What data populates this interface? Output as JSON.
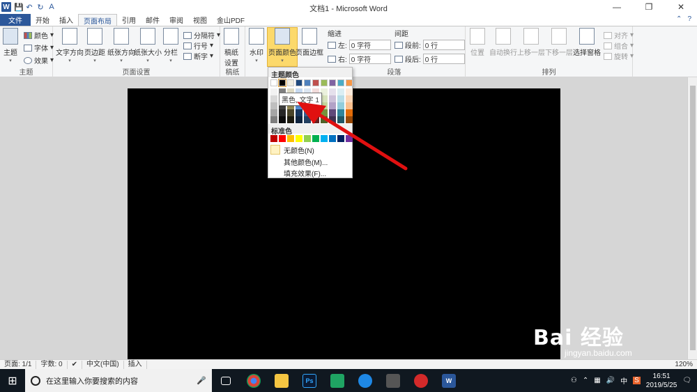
{
  "window": {
    "title": "文档1 - Microsoft Word",
    "minimize": "—",
    "restore": "❐",
    "close": "✕"
  },
  "qat": {
    "logo": "W",
    "save": "💾",
    "undo": "↶",
    "redo": "↻",
    "format": "A"
  },
  "tabs": [
    "文件",
    "开始",
    "插入",
    "页面布局",
    "引用",
    "邮件",
    "审阅",
    "视图",
    "金山PDF"
  ],
  "active_tab": "页面布局",
  "ribbon": {
    "theme_group": {
      "label": "主题",
      "theme_btn": "主题",
      "colors": "颜色",
      "fonts": "字体",
      "effects": "效果"
    },
    "page_setup": {
      "label": "页面设置",
      "text_dir": "文字方向",
      "margins": "页边距",
      "orientation": "纸张方向",
      "size": "纸张大小",
      "columns": "分栏",
      "breaks": "分隔符",
      "line_numbers": "行号",
      "hyphenation": "断字"
    },
    "draft": {
      "label": "稿纸",
      "btn_line1": "稿纸",
      "btn_line2": "设置"
    },
    "background": {
      "watermark": "水印",
      "page_color": "页面颜色",
      "page_border": "页面边框"
    },
    "paragraph": {
      "label": "段落",
      "indent": "缩进",
      "spacing": "间距",
      "left_label": "左:",
      "left_val": "0 字符",
      "right_label": "右:",
      "right_val": "0 字符",
      "before_label": "段前:",
      "before_val": "0 行",
      "after_label": "段后:",
      "after_val": "0 行"
    },
    "arrange": {
      "label": "排列",
      "position": "位置",
      "wrap": "自动换行",
      "forward": "上移一层",
      "backward": "下移一层",
      "selection": "选择窗格",
      "align": "对齐",
      "group": "组合",
      "rotate": "旋转"
    }
  },
  "page_color_menu": {
    "theme_colors_header": "主题颜色",
    "standard_colors_header": "标准色",
    "no_color": "无颜色(N)",
    "more_colors": "其他颜色(M)...",
    "fill_effects": "填充效果(F)...",
    "tooltip": "黑色, 文字 1",
    "theme_colors": [
      "#ffffff",
      "#000000",
      "#eeece1",
      "#1f497d",
      "#4f81bd",
      "#c0504d",
      "#9bbb59",
      "#8064a2",
      "#4bacc6",
      "#f79646"
    ],
    "theme_shades": [
      [
        "#f2f2f2",
        "#7f7f7f",
        "#ddd9c3",
        "#c6d9f0",
        "#dbe5f1",
        "#f2dcdb",
        "#ebf1dd",
        "#e5e0ec",
        "#dbeef3",
        "#fdeada"
      ],
      [
        "#d8d8d8",
        "#595959",
        "#c4bd97",
        "#8db3e2",
        "#b8cce4",
        "#e5b9b7",
        "#d7e3bc",
        "#ccc1d9",
        "#b7dde8",
        "#fbd5b5"
      ],
      [
        "#bfbfbf",
        "#3f3f3f",
        "#938953",
        "#548dd4",
        "#95b3d7",
        "#d99694",
        "#c3d69b",
        "#b2a2c7",
        "#92cddc",
        "#fac08f"
      ],
      [
        "#a5a5a5",
        "#262626",
        "#494429",
        "#17365d",
        "#366092",
        "#953734",
        "#76923c",
        "#5f497a",
        "#31859b",
        "#e36c09"
      ],
      [
        "#7f7f7f",
        "#0c0c0c",
        "#1d1b10",
        "#0f243e",
        "#244061",
        "#632423",
        "#4f6128",
        "#3f3151",
        "#205867",
        "#974806"
      ]
    ],
    "standard_colors": [
      "#c00000",
      "#ff0000",
      "#ffc000",
      "#ffff00",
      "#92d050",
      "#00b050",
      "#00b0f0",
      "#0070c0",
      "#002060",
      "#7030a0"
    ]
  },
  "status": {
    "page": "页面: 1/1",
    "words": "字数: 0",
    "lang": "中文(中国)",
    "mode": "插入",
    "zoom": "120%"
  },
  "taskbar": {
    "search_placeholder": "在这里输入你要搜索的内容",
    "time": "16:51",
    "date": "2019/5/25",
    "ime": "中"
  },
  "watermark": {
    "brand": "Bai 经验",
    "url": "jingyan.baidu.com"
  }
}
